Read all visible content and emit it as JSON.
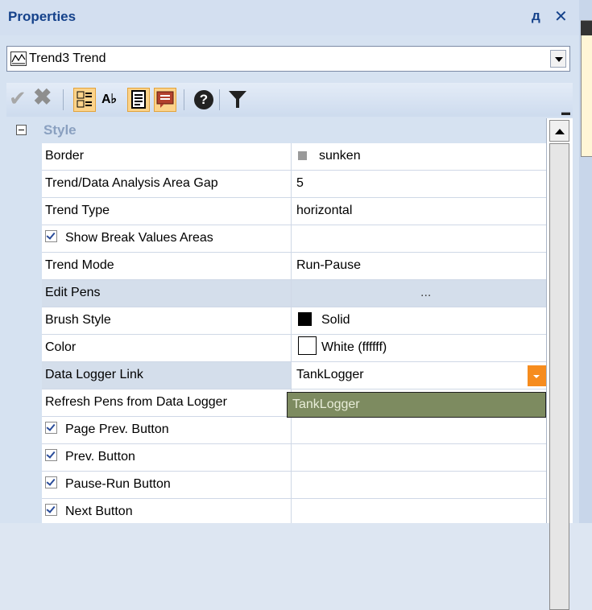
{
  "window": {
    "title": "Properties",
    "pin_glyph": "д",
    "close_glyph": "✕"
  },
  "object_selector": {
    "value": "Trend3 Trend"
  },
  "toolbar": {
    "buttons": [
      "apply",
      "cancel",
      "categorized",
      "alphabetical",
      "property-pages",
      "events",
      "help",
      "filter"
    ],
    "ab_label": "A♭"
  },
  "grid": {
    "category": "Style",
    "properties": [
      {
        "name": "Border",
        "value": "sunken"
      },
      {
        "name": "Trend/Data Analysis Area Gap",
        "value": "5"
      },
      {
        "name": "Trend Type",
        "value": "horizontal"
      },
      {
        "name": "Show Break Values Areas",
        "value": "",
        "checked": true
      },
      {
        "name": "Trend Mode",
        "value": "Run-Pause"
      },
      {
        "name": "Edit Pens",
        "value": "..."
      },
      {
        "name": "Brush Style",
        "value": "Solid"
      },
      {
        "name": "Color",
        "value": "White (ffffff)"
      },
      {
        "name": "Data Logger Link",
        "value": "TankLogger"
      },
      {
        "name": "Refresh Pens from Data Logger",
        "value": ""
      },
      {
        "name": "Page Prev. Button",
        "value": "",
        "checked": true
      },
      {
        "name": "Prev. Button",
        "value": "",
        "checked": true
      },
      {
        "name": "Pause-Run Button",
        "value": "",
        "checked": true
      },
      {
        "name": "Next Button",
        "value": "",
        "checked": true
      }
    ],
    "dropdown_option": "TankLogger"
  },
  "colors": {
    "accent": "#15428b",
    "dropdown_button": "#f68c1e",
    "dropdown_selection": "#7d8b60",
    "brush_swatch": "#000000",
    "color_swatch": "#ffffff"
  }
}
